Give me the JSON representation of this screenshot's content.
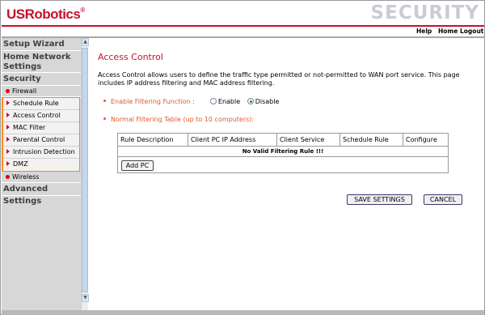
{
  "header": {
    "logo": "USRobotics",
    "logo_mark": "®",
    "title": "SECURITY",
    "links": [
      "Help",
      "Home",
      "Logout"
    ]
  },
  "sidebar": {
    "setup_wizard": "Setup Wizard",
    "home_network_settings_1": "Home Network",
    "home_network_settings_2": "Settings",
    "security": "Security",
    "firewall": "Firewall",
    "firewall_items": [
      "Schedule Rule",
      "Access Control",
      "MAC Filter",
      "Parental Control",
      "Intrusion Detection",
      "DMZ"
    ],
    "wireless": "Wireless",
    "advanced_settings": "Advanced Settings"
  },
  "scrollbar": {
    "up": "▲",
    "down": "▼"
  },
  "main": {
    "title": "Access Control",
    "description": "Access Control allows users to define the traffic type permitted or not-permitted to WAN port service. This page includes IP address filtering and MAC address filtering.",
    "enable_filtering_label": "Enable Filtering Function :",
    "enable_option": "Enable",
    "disable_option": "Disable",
    "selected_option": "Disable",
    "normal_filtering_label": "Normal Filtering Table (up to 10 computers):",
    "table": {
      "columns": [
        "Rule Description",
        "Client PC IP Address",
        "Client Service",
        "Schedule Rule",
        "Configure"
      ],
      "empty_message": "No Valid Filtering Rule !!!"
    },
    "add_pc_button": "Add PC",
    "save_button": "SAVE SETTINGS",
    "cancel_button": "CANCEL"
  },
  "colors": {
    "brand_red": "#c8102e",
    "option_orange": "#e05a2b",
    "firewall_border": "#ff8a00",
    "sidebar_bg": "#d7d7d7"
  }
}
